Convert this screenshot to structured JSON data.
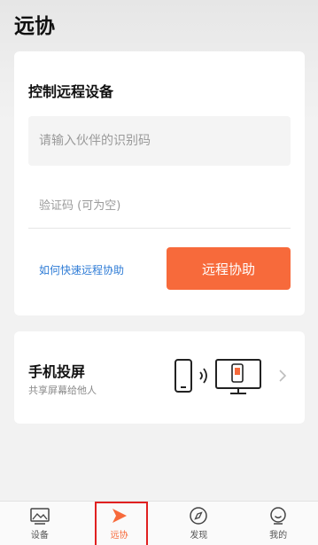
{
  "header": {
    "title": "远协"
  },
  "remote_card": {
    "title": "控制远程设备",
    "partner_id_placeholder": "请输入伙伴的识别码",
    "verification_placeholder": "验证码 (可为空)",
    "help_link": "如何快速远程协助",
    "assist_button": "远程协助"
  },
  "cast_card": {
    "title": "手机投屏",
    "subtitle": "共享屏幕给他人",
    "illustration_icons": [
      "phone-icon",
      "signal-waves-icon",
      "monitor-icon"
    ]
  },
  "tabbar": {
    "tabs": [
      {
        "label": "设备",
        "icon": "device-image-icon",
        "active": false
      },
      {
        "label": "远协",
        "icon": "remote-play-icon",
        "active": true
      },
      {
        "label": "发现",
        "icon": "compass-icon",
        "active": false
      },
      {
        "label": "我的",
        "icon": "profile-icon",
        "active": false
      }
    ]
  },
  "colors": {
    "accent": "#f76a3b",
    "link": "#2f7cd6",
    "highlight_box": "#e02020"
  }
}
